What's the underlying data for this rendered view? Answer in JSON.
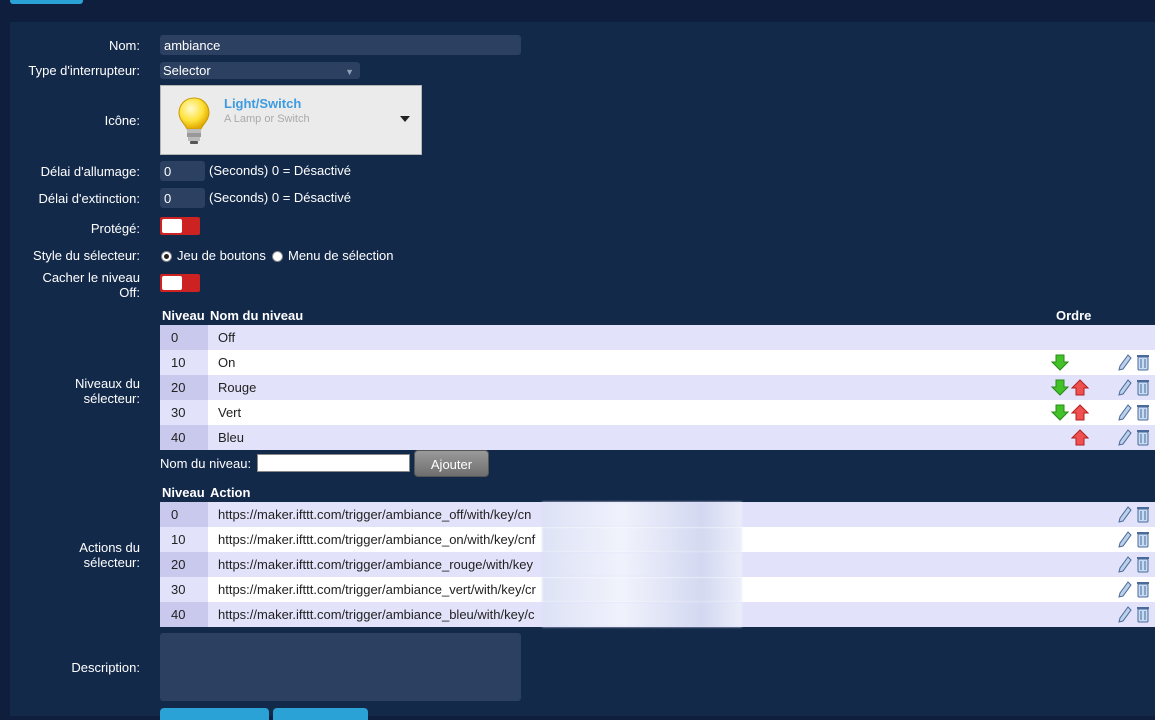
{
  "form": {
    "name_label": "Nom:",
    "name_value": "ambiance",
    "switch_type_label": "Type d'interrupteur:",
    "switch_type_value": "Selector",
    "icon_label": "Icône:",
    "icon_title": "Light/Switch",
    "icon_subtitle": "A Lamp or Switch",
    "on_delay_label": "Délai d'allumage:",
    "on_delay_value": "0",
    "on_delay_hint": "(Seconds) 0 = Désactivé",
    "off_delay_label": "Délai d'extinction:",
    "off_delay_value": "0",
    "off_delay_hint": "(Seconds) 0 = Désactivé",
    "protected_label": "Protégé:",
    "selector_style_label": "Style du sélecteur:",
    "style_option_buttons": "Jeu de boutons",
    "style_option_menu": "Menu de sélection",
    "hide_off_label_line1": "Cacher le niveau",
    "hide_off_label_line2": "Off:",
    "levels_label_line1": "Niveaux du",
    "levels_label_line2": "sélecteur:",
    "actions_label_line1": "Actions du",
    "actions_label_line2": "sélecteur:",
    "description_label": "Description:"
  },
  "levels_table": {
    "col_level": "Niveau",
    "col_name": "Nom du niveau",
    "col_order": "Ordre",
    "rows": [
      {
        "level": "0",
        "name": "Off"
      },
      {
        "level": "10",
        "name": "On"
      },
      {
        "level": "20",
        "name": "Rouge"
      },
      {
        "level": "30",
        "name": "Vert"
      },
      {
        "level": "40",
        "name": "Bleu"
      }
    ]
  },
  "add_level": {
    "label": "Nom du niveau:",
    "button": "Ajouter"
  },
  "actions_table": {
    "col_level": "Niveau",
    "col_action": "Action",
    "rows": [
      {
        "level": "0",
        "action": "https://maker.ifttt.com/trigger/ambiance_off/with/key/cn"
      },
      {
        "level": "10",
        "action": "https://maker.ifttt.com/trigger/ambiance_on/with/key/cnf"
      },
      {
        "level": "20",
        "action": "https://maker.ifttt.com/trigger/ambiance_rouge/with/key"
      },
      {
        "level": "30",
        "action": "https://maker.ifttt.com/trigger/ambiance_vert/with/key/cr"
      },
      {
        "level": "40",
        "action": "https://maker.ifttt.com/trigger/ambiance_bleu/with/key/c"
      }
    ]
  },
  "colors": {
    "background": "#0e1e3c",
    "panel": "#13294a",
    "accent": "#2aa2d6",
    "toggle_off": "#cc2222"
  }
}
